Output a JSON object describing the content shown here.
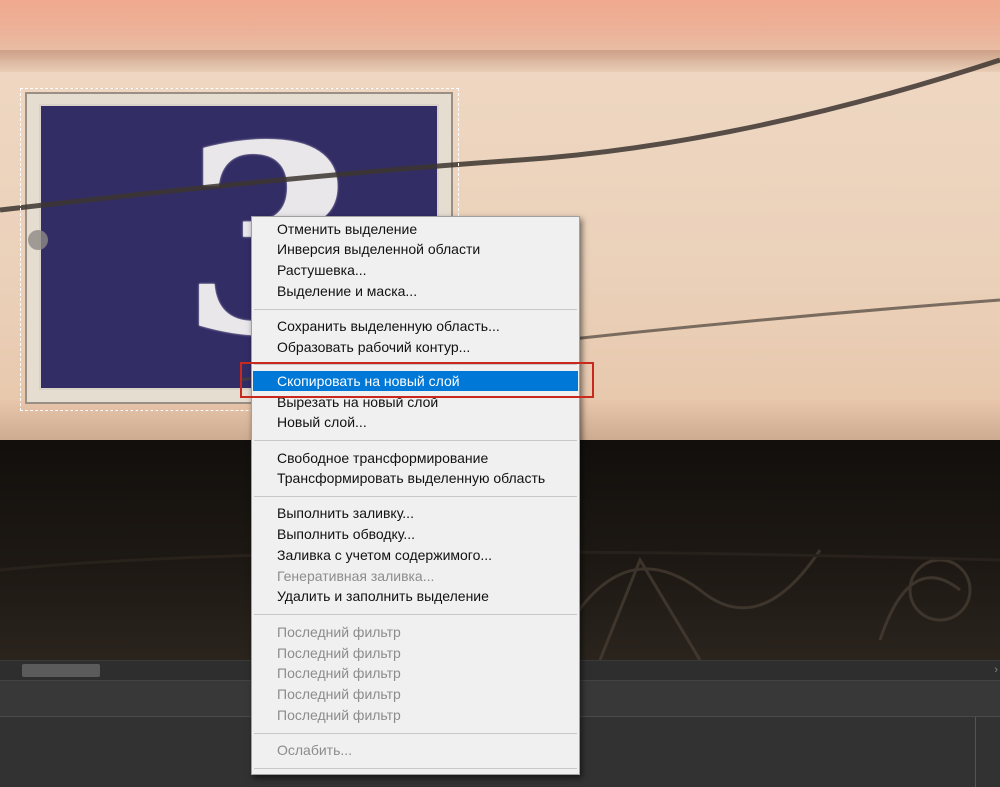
{
  "context_menu": {
    "group1": [
      "Отменить выделение",
      "Инверсия выделенной области",
      "Растушевка...",
      "Выделение и маска..."
    ],
    "group2": [
      "Сохранить выделенную область...",
      "Образовать рабочий контур..."
    ],
    "group3": [
      "Скопировать на новый слой",
      "Вырезать на новый слой",
      "Новый слой..."
    ],
    "group4": [
      "Свободное трансформирование",
      "Трансформировать выделенную область"
    ],
    "group5": [
      "Выполнить заливку...",
      "Выполнить обводку...",
      "Заливка с учетом содержимого...",
      "Генеративная заливка...",
      "Удалить и заполнить выделение"
    ],
    "group6": [
      "Последний фильтр",
      "Последний фильтр",
      "Последний фильтр",
      "Последний фильтр",
      "Последний фильтр"
    ],
    "group7": [
      "Ослабить..."
    ],
    "highlighted_item": "Скопировать на новый слой"
  },
  "canvas": {
    "plate_digit": "3"
  },
  "colors": {
    "highlight": "#0078d7",
    "callout_border": "#c8281e",
    "plate_blue": "#332d66"
  }
}
